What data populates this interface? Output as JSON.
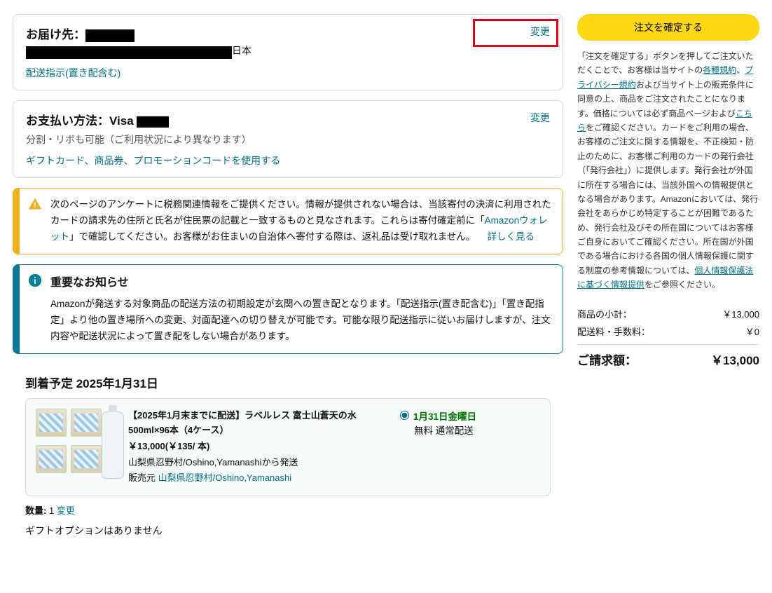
{
  "address": {
    "title_prefix": "お届け先：",
    "country_suffix": "日本",
    "instructions_link": "配送指示(置き配含む)",
    "change_label": "変更"
  },
  "payment": {
    "title_prefix": "お支払い方法：Visa ",
    "sub": "分割・リボも可能（ご利用状況により異なります）",
    "promo_link": "ギフトカード、商品券、プロモーションコードを使用する",
    "change_label": "変更"
  },
  "alert_warning": {
    "text_before": "次のページのアンケートに税務関連情報をご提供ください。情報が提供されない場合は、当該寄付の決済に利用されたカードの請求先の住所と氏名が住民票の記載と一致するものと見なされます。これらは寄付確定前に「",
    "wallet_link": "Amazonウォレット",
    "text_after": "」で確認してください。お客様がお住まいの自治体へ寄付する際は、返礼品は受け取れません。",
    "more_link": "詳しく見る"
  },
  "alert_info": {
    "title": "重要なお知らせ",
    "text": "Amazonが発送する対象商品の配送方法の初期設定が玄関への置き配となります。「配送指示(置き配含む)」「置き配指定」より他の置き場所への変更、対面配達への切り替えが可能です。可能な限り配送指示に従いお届けしますが、注文内容や配送状況によって置き配をしない場合があります。"
  },
  "delivery": {
    "arrival_title": "到着予定 2025年1月31日",
    "item": {
      "name": "【2025年1月末までに配送】ラベルレス 富士山蒼天の水 500ml×96本（4ケース）",
      "price": "￥13,000(￥135/ 本)",
      "ship_from": "山梨県忍野村/Oshino,Yamanashiから発送",
      "seller_label": "販売元",
      "seller_link": "山梨県忍野村/Oshino,Yamanashi"
    },
    "option": {
      "date": "1月31日金曜日",
      "method": "無料 通常配送"
    },
    "qty_label": "数量:",
    "qty_value": "1",
    "qty_change": "変更",
    "gift": "ギフトオプションはありません"
  },
  "side": {
    "confirm_button": "注文を確定する",
    "legal_before": "「注文を確定する」ボタンを押してご注文いただくことで、お客様は当サイトの",
    "terms_link": "各種規約",
    "sep1": "、",
    "privacy_link": "プライバシー規約",
    "legal_mid1": "および当サイト上の販売条件に同意の上、商品をご注文されたことになります。価格については必ず商品ページおよび",
    "here_link": "こちら",
    "legal_mid2": "をご確認ください。カードをご利用の場合、お客様のご注文に関する情報を、不正検知・防止のために、お客様ご利用のカードの発行会社（「発行会社」）に提供します。発行会社が外国に所在する場合には、当該外国への情報提供となる場合があります。Amazonにおいては、発行会社をあらかじめ特定することが困難であるため、発行会社及びその所在国についてはお客様ご自身においてご確認ください。所在国が外国である場合における各国の個人情報保護に関する制度の参考情報については、",
    "appi_link": "個人情報保護法に基づく情報提供",
    "legal_end": "をご参照ください。"
  },
  "totals": {
    "subtotal_label": "商品の小計：",
    "subtotal_value": "￥13,000",
    "shipping_label": "配送料・手数料：",
    "shipping_value": "￥0",
    "grand_label": "ご請求額：",
    "grand_value": "￥13,000"
  }
}
